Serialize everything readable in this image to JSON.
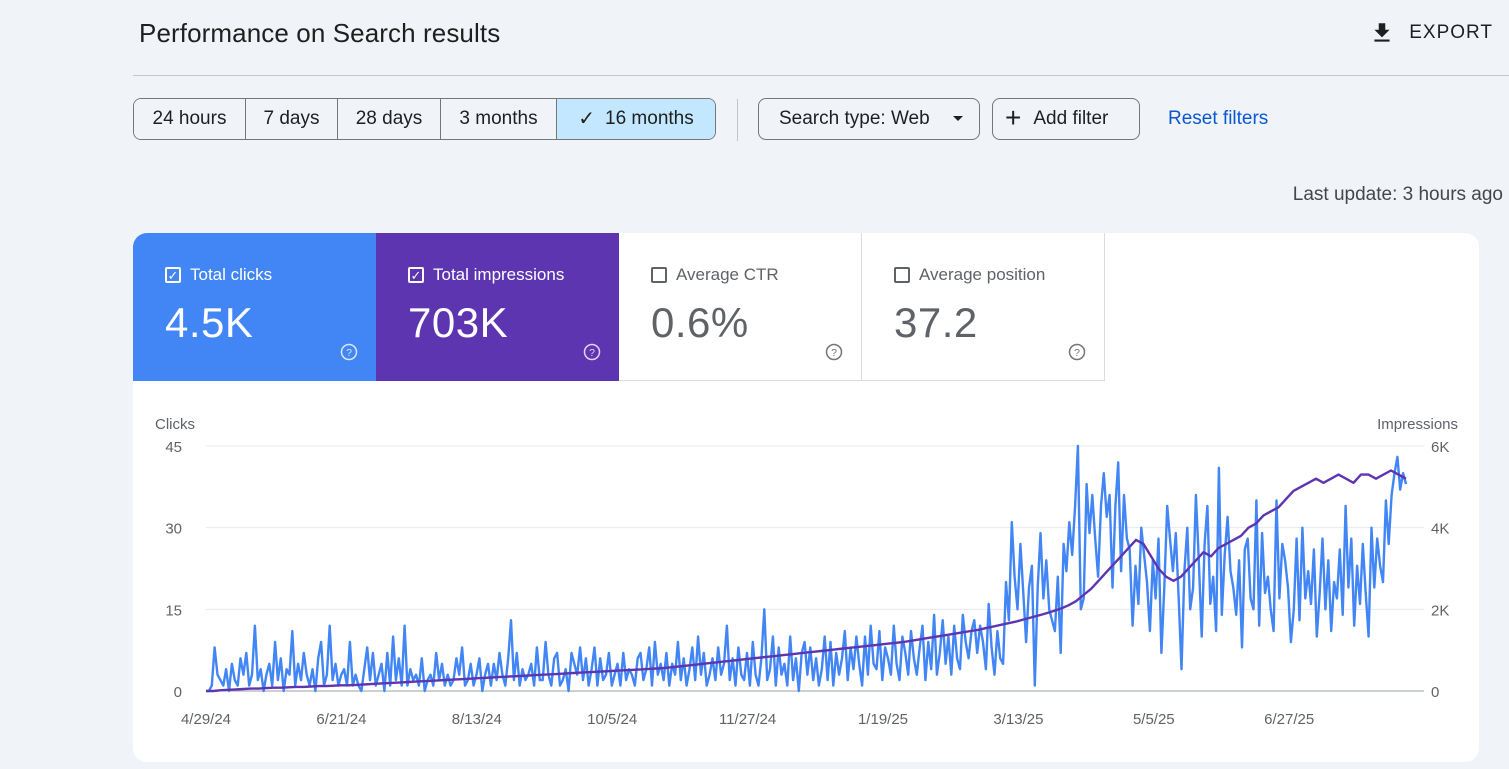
{
  "header": {
    "title": "Performance on Search results",
    "export_label": "EXPORT"
  },
  "filters": {
    "ranges": [
      {
        "label": "24 hours",
        "selected": false
      },
      {
        "label": "7 days",
        "selected": false
      },
      {
        "label": "28 days",
        "selected": false
      },
      {
        "label": "3 months",
        "selected": false
      },
      {
        "label": "16 months",
        "selected": true
      }
    ],
    "search_type": "Search type: Web",
    "add_filter": "Add filter",
    "reset": "Reset filters"
  },
  "last_update": "Last update: 3 hours ago",
  "metrics": [
    {
      "label": "Total clicks",
      "value": "4.5K",
      "checked": true,
      "color": "#4285f4"
    },
    {
      "label": "Total impressions",
      "value": "703K",
      "checked": true,
      "color": "#5e35b1"
    },
    {
      "label": "Average CTR",
      "value": "0.6%",
      "checked": false
    },
    {
      "label": "Average position",
      "value": "37.2",
      "checked": false
    }
  ],
  "chart_data": {
    "type": "line",
    "ylabel_left": "Clicks",
    "ylabel_right": "Impressions",
    "y_left_ticks": [
      "0",
      "15",
      "30",
      "45"
    ],
    "y_right_ticks": [
      "0",
      "2K",
      "4K",
      "6K"
    ],
    "ylim_left": [
      0,
      45
    ],
    "ylim_right": [
      0,
      6000
    ],
    "x_ticks": [
      "4/29/24",
      "6/21/24",
      "8/13/24",
      "10/5/24",
      "11/27/24",
      "1/19/25",
      "3/13/25",
      "5/5/25",
      "6/27/25"
    ],
    "grid": true,
    "series": [
      {
        "name": "Clicks",
        "color": "#4285f4",
        "axis": "left",
        "x_start": "4/29/24",
        "x_end": "8/14/25",
        "values": [
          0,
          0,
          1,
          8,
          3,
          2,
          1,
          4,
          0,
          5,
          2,
          1,
          6,
          3,
          7,
          1,
          3,
          12,
          2,
          4,
          0,
          3,
          5,
          1,
          9,
          2,
          6,
          0,
          4,
          3,
          11,
          1,
          5,
          2,
          7,
          3,
          1,
          4,
          0,
          6,
          9,
          1,
          3,
          12,
          2,
          5,
          1,
          3,
          4,
          1,
          9,
          1,
          3,
          1,
          0,
          4,
          8,
          2,
          7,
          1,
          3,
          5,
          0,
          7,
          1,
          10,
          2,
          6,
          1,
          12,
          1,
          4,
          2,
          3,
          1,
          6,
          0,
          2,
          3,
          1,
          7,
          2,
          5,
          1,
          3,
          1,
          2,
          6,
          3,
          8,
          1,
          2,
          5,
          1,
          3,
          6,
          0,
          3,
          5,
          1,
          5,
          2,
          7,
          3,
          1,
          6,
          13,
          2,
          7,
          1,
          4,
          2,
          3,
          5,
          1,
          8,
          2,
          2,
          9,
          3,
          1,
          6,
          7,
          1,
          2,
          4,
          0,
          7,
          5,
          3,
          8,
          2,
          6,
          1,
          4,
          8,
          1,
          6,
          2,
          3,
          7,
          1,
          3,
          5,
          1,
          7,
          2,
          4,
          3,
          1,
          6,
          7,
          2,
          4,
          8,
          1,
          9,
          3,
          5,
          2,
          7,
          1,
          5,
          3,
          9,
          2,
          6,
          1,
          4,
          8,
          2,
          10,
          3,
          7,
          1,
          3,
          6,
          2,
          8,
          3,
          5,
          12,
          2,
          6,
          1,
          8,
          3,
          2,
          7,
          1,
          9,
          3,
          1,
          6,
          15,
          2,
          4,
          10,
          1,
          8,
          3,
          5,
          1,
          10,
          2,
          6,
          0,
          7,
          9,
          3,
          8,
          2,
          6,
          1,
          4,
          10,
          2,
          9,
          1,
          7,
          3,
          6,
          11,
          2,
          8,
          4,
          10,
          5,
          1,
          10,
          3,
          12,
          5,
          4,
          11,
          2,
          8,
          6,
          3,
          12,
          5,
          2,
          10,
          7,
          3,
          11,
          6,
          3,
          8,
          12,
          2,
          9,
          4,
          14,
          3,
          7,
          13,
          5,
          10,
          3,
          12,
          6,
          4,
          14,
          9,
          6,
          11,
          13,
          7,
          12,
          9,
          4,
          16,
          8,
          3,
          11,
          6,
          5,
          20,
          13,
          31,
          21,
          15,
          27,
          18,
          9,
          19,
          23,
          1,
          19,
          29,
          17,
          24,
          15,
          13,
          11,
          21,
          7,
          27,
          22,
          31,
          25,
          34,
          45,
          15,
          17,
          38,
          29,
          36,
          28,
          21,
          34,
          40,
          32,
          36,
          19,
          34,
          42,
          22,
          36,
          28,
          26,
          12,
          23,
          16,
          30,
          25,
          20,
          11,
          24,
          17,
          28,
          7,
          19,
          34,
          28,
          22,
          29,
          17,
          4,
          22,
          30,
          15,
          19,
          36,
          24,
          10,
          27,
          34,
          16,
          21,
          11,
          41,
          14,
          25,
          32,
          22,
          19,
          14,
          24,
          8,
          26,
          28,
          17,
          15,
          35,
          12,
          29,
          18,
          21,
          15,
          11,
          35,
          17,
          27,
          24,
          19,
          9,
          15,
          28,
          13,
          30,
          17,
          22,
          16,
          26,
          10,
          18,
          28,
          15,
          24,
          11,
          20,
          17,
          26,
          14,
          34,
          19,
          28,
          12,
          23,
          16,
          27,
          18,
          10,
          30,
          19,
          28,
          23,
          20,
          35,
          27,
          36,
          40,
          43,
          37,
          40,
          38
        ],
        "note": ""
      },
      {
        "name": "Impressions",
        "color": "#5e35b1",
        "axis": "right",
        "values": [
          0,
          0,
          20,
          30,
          40,
          50,
          60,
          60,
          70,
          80,
          80,
          90,
          100,
          100,
          110,
          120,
          120,
          130,
          140,
          140,
          150,
          160,
          170,
          180,
          190,
          200,
          210,
          220,
          230,
          240,
          250,
          260,
          270,
          280,
          290,
          300,
          310,
          320,
          330,
          340,
          350,
          360,
          370,
          380,
          390,
          400,
          410,
          420,
          430,
          440,
          450,
          460,
          470,
          480,
          490,
          500,
          510,
          520,
          530,
          540,
          550,
          560,
          580,
          600,
          620,
          640,
          660,
          680,
          700,
          720,
          740,
          760,
          780,
          800,
          820,
          840,
          860,
          880,
          900,
          920,
          940,
          960,
          980,
          1000,
          1020,
          1040,
          1060,
          1080,
          1100,
          1120,
          1140,
          1160,
          1180,
          1200,
          1230,
          1260,
          1290,
          1320,
          1350,
          1380,
          1410,
          1440,
          1470,
          1500,
          1540,
          1580,
          1620,
          1660,
          1700,
          1750,
          1800,
          1850,
          1900,
          1960,
          2020,
          2100,
          2200,
          2350,
          2500,
          2700,
          2900,
          3100,
          3300,
          3500,
          3700,
          3600,
          3300,
          3000,
          2800,
          2700,
          2800,
          3000,
          3200,
          3400,
          3300,
          3500,
          3600,
          3700,
          3800,
          4000,
          4100,
          4300,
          4400,
          4500,
          4700,
          4900,
          5000,
          5100,
          5200,
          5100,
          5200,
          5300,
          5200,
          5100,
          5300,
          5300,
          5200,
          5300,
          5400,
          5300,
          5200
        ],
        "note": ""
      }
    ]
  }
}
